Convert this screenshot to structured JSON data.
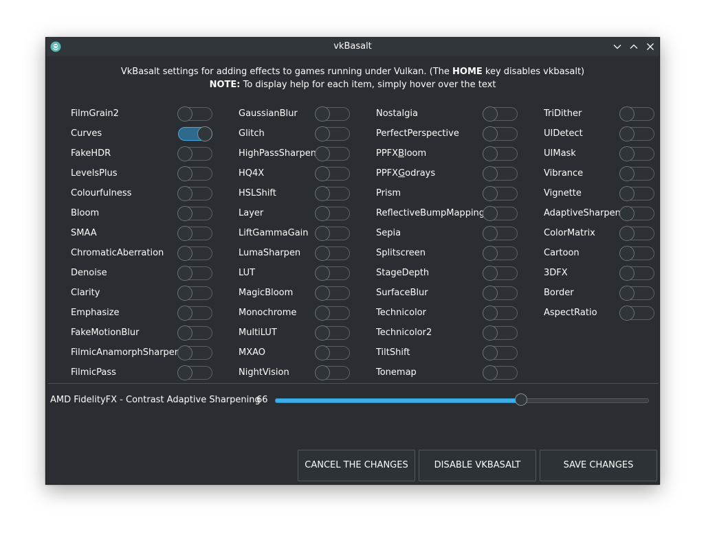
{
  "window": {
    "title": "vkBasalt"
  },
  "header": {
    "line1_prefix": "VkBasalt settings for adding effects to games running under Vulkan. (The ",
    "line1_key": "HOME",
    "line1_suffix": " key disables vkbasalt)",
    "line2_bold": "NOTE:",
    "line2_text": " To display help for each item, simply hover over the text"
  },
  "effects": {
    "columns": [
      [
        {
          "label": "FilmGrain2",
          "on": false
        },
        {
          "label": "Curves",
          "on": true
        },
        {
          "label": "FakeHDR",
          "on": false
        },
        {
          "label": "LevelsPlus",
          "on": false
        },
        {
          "label": "Colourfulness",
          "on": false
        },
        {
          "label": "Bloom",
          "on": false
        },
        {
          "label": "SMAA",
          "on": false
        },
        {
          "label": "ChromaticAberration",
          "on": false
        },
        {
          "label": "Denoise",
          "on": false
        },
        {
          "label": "Clarity",
          "on": false
        },
        {
          "label": "Emphasize",
          "on": false
        },
        {
          "label": "FakeMotionBlur",
          "on": false
        },
        {
          "label": "FilmicAnamorphSharpen",
          "on": false
        },
        {
          "label": "FilmicPass",
          "on": false
        }
      ],
      [
        {
          "label": "GaussianBlur",
          "on": false
        },
        {
          "label": "Glitch",
          "on": false
        },
        {
          "label": "HighPassSharpen",
          "on": false
        },
        {
          "label": "HQ4X",
          "on": false
        },
        {
          "label": "HSLShift",
          "on": false
        },
        {
          "label": "Layer",
          "on": false
        },
        {
          "label": "LiftGammaGain",
          "on": false
        },
        {
          "label": "LumaSharpen",
          "on": false
        },
        {
          "label": "LUT",
          "on": false
        },
        {
          "label": "MagicBloom",
          "on": false
        },
        {
          "label": "Monochrome",
          "on": false
        },
        {
          "label": "MultiLUT",
          "on": false
        },
        {
          "label": "MXAO",
          "on": false
        },
        {
          "label": "NightVision",
          "on": false
        }
      ],
      [
        {
          "label": "Nostalgia",
          "on": false
        },
        {
          "label": "PerfectPerspective",
          "on": false
        },
        {
          "label": "PPFXBloom",
          "on": false,
          "mnemonic_index": 4
        },
        {
          "label": "PPFXGodrays",
          "on": false,
          "mnemonic_index": 4
        },
        {
          "label": "Prism",
          "on": false
        },
        {
          "label": "ReflectiveBumpMapping",
          "on": false
        },
        {
          "label": "Sepia",
          "on": false
        },
        {
          "label": "Splitscreen",
          "on": false
        },
        {
          "label": "StageDepth",
          "on": false
        },
        {
          "label": "SurfaceBlur",
          "on": false
        },
        {
          "label": "Technicolor",
          "on": false
        },
        {
          "label": "Technicolor2",
          "on": false
        },
        {
          "label": "TiltShift",
          "on": false
        },
        {
          "label": "Tonemap",
          "on": false
        }
      ],
      [
        {
          "label": "TriDither",
          "on": false
        },
        {
          "label": "UIDetect",
          "on": false
        },
        {
          "label": "UIMask",
          "on": false
        },
        {
          "label": "Vibrance",
          "on": false
        },
        {
          "label": "Vignette",
          "on": false
        },
        {
          "label": "AdaptiveSharpen",
          "on": false
        },
        {
          "label": "ColorMatrix",
          "on": false
        },
        {
          "label": "Cartoon",
          "on": false
        },
        {
          "label": "3DFX",
          "on": false
        },
        {
          "label": "Border",
          "on": false
        },
        {
          "label": "AspectRatio",
          "on": false
        }
      ]
    ]
  },
  "cas_slider": {
    "label": "AMD FidelityFX - Contrast Adaptive Sharpening",
    "value": "66",
    "min": 0,
    "max": 100
  },
  "buttons": {
    "cancel": "CANCEL THE CHANGES",
    "disable": "DISABLE VKBASALT",
    "save": "SAVE CHANGES"
  },
  "colors": {
    "window_bg": "#2a2e32",
    "titlebar_bg": "#31363b",
    "accent": "#3daee9",
    "text": "#fcfcfc"
  }
}
